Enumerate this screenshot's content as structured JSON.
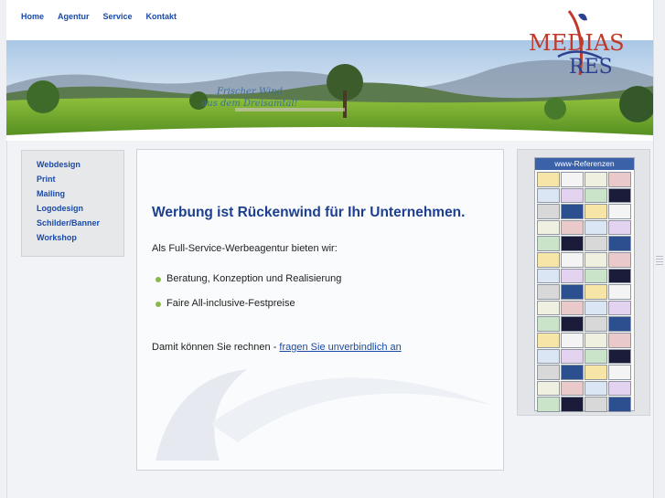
{
  "nav": {
    "items": [
      {
        "label": "Home"
      },
      {
        "label": "Agentur"
      },
      {
        "label": "Service"
      },
      {
        "label": "Kontakt"
      }
    ]
  },
  "logo": {
    "line1": "MEDIAS",
    "line2": "RES"
  },
  "banner": {
    "slogan_line1": "Frischer Wind",
    "slogan_line2": "aus dem Dreisamtal!"
  },
  "sidebar": {
    "items": [
      {
        "label": "Webdesign"
      },
      {
        "label": "Print"
      },
      {
        "label": "Mailing"
      },
      {
        "label": "Logodesign"
      },
      {
        "label": "Schilder/Banner"
      },
      {
        "label": "Workshop"
      }
    ]
  },
  "main": {
    "headline": "Werbung ist Rückenwind für Ihr Unternehmen.",
    "intro": "Als Full-Service-Werbeagentur bieten wir:",
    "bullets": [
      {
        "text": "Beratung, Konzeption und Realisierung"
      },
      {
        "text": "Faire All-inclusive-Festpreise"
      }
    ],
    "calc_text": "Damit können Sie rechnen - ",
    "calc_link": "fragen Sie unverbindlich an"
  },
  "references": {
    "title": "www-Referenzen"
  },
  "colors": {
    "nav": "#1a4aa8",
    "headline": "#1d3f8f",
    "bullet": "#8ab84a",
    "logo_red": "#c0392b",
    "logo_blue": "#2d3f8f"
  }
}
